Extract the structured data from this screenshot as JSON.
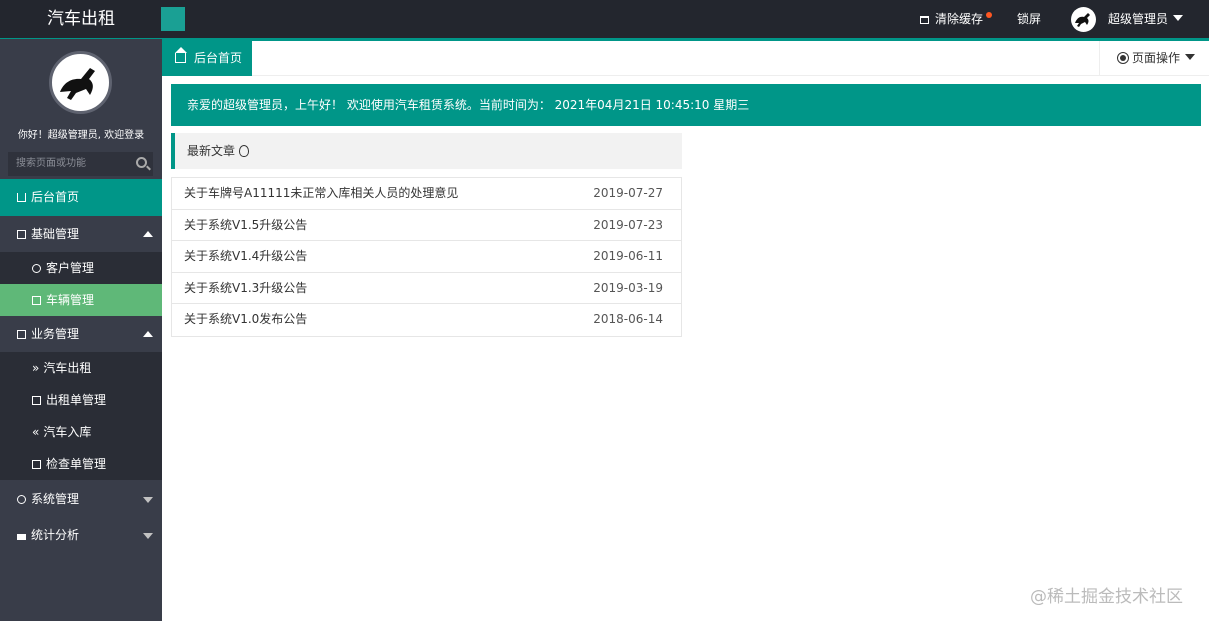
{
  "header": {
    "app_title": "汽车出租",
    "clear_cache": "清除缓存",
    "lock": "锁屏",
    "user": "超级管理员"
  },
  "sidebar": {
    "welcome": "你好！超级管理员, 欢迎登录",
    "search_placeholder": "搜索页面或功能",
    "home": "后台首页",
    "groups": [
      {
        "label": "基础管理",
        "items": [
          "客户管理",
          "车辆管理"
        ]
      },
      {
        "label": "业务管理",
        "items": [
          "汽车出租",
          "出租单管理",
          "汽车入库",
          "检查单管理"
        ]
      },
      {
        "label": "系统管理"
      },
      {
        "label": "统计分析"
      }
    ]
  },
  "tabs": {
    "home": "后台首页",
    "page_ops": "页面操作"
  },
  "banner": "亲爱的超级管理员，上午好！ 欢迎使用汽车租赁系统。当前时间为： 2021年04月21日 10:45:10 星期三",
  "articles": {
    "title": "最新文章",
    "items": [
      {
        "title": "关于车牌号A11111未正常入库相关人员的处理意见",
        "date": "2019-07-27"
      },
      {
        "title": "关于系统V1.5升级公告",
        "date": "2019-07-23"
      },
      {
        "title": "关于系统V1.4升级公告",
        "date": "2019-06-11"
      },
      {
        "title": "关于系统V1.3升级公告",
        "date": "2019-03-19"
      },
      {
        "title": "关于系统V1.0发布公告",
        "date": "2018-06-14"
      }
    ]
  },
  "watermark": "@稀土掘金技术社区"
}
